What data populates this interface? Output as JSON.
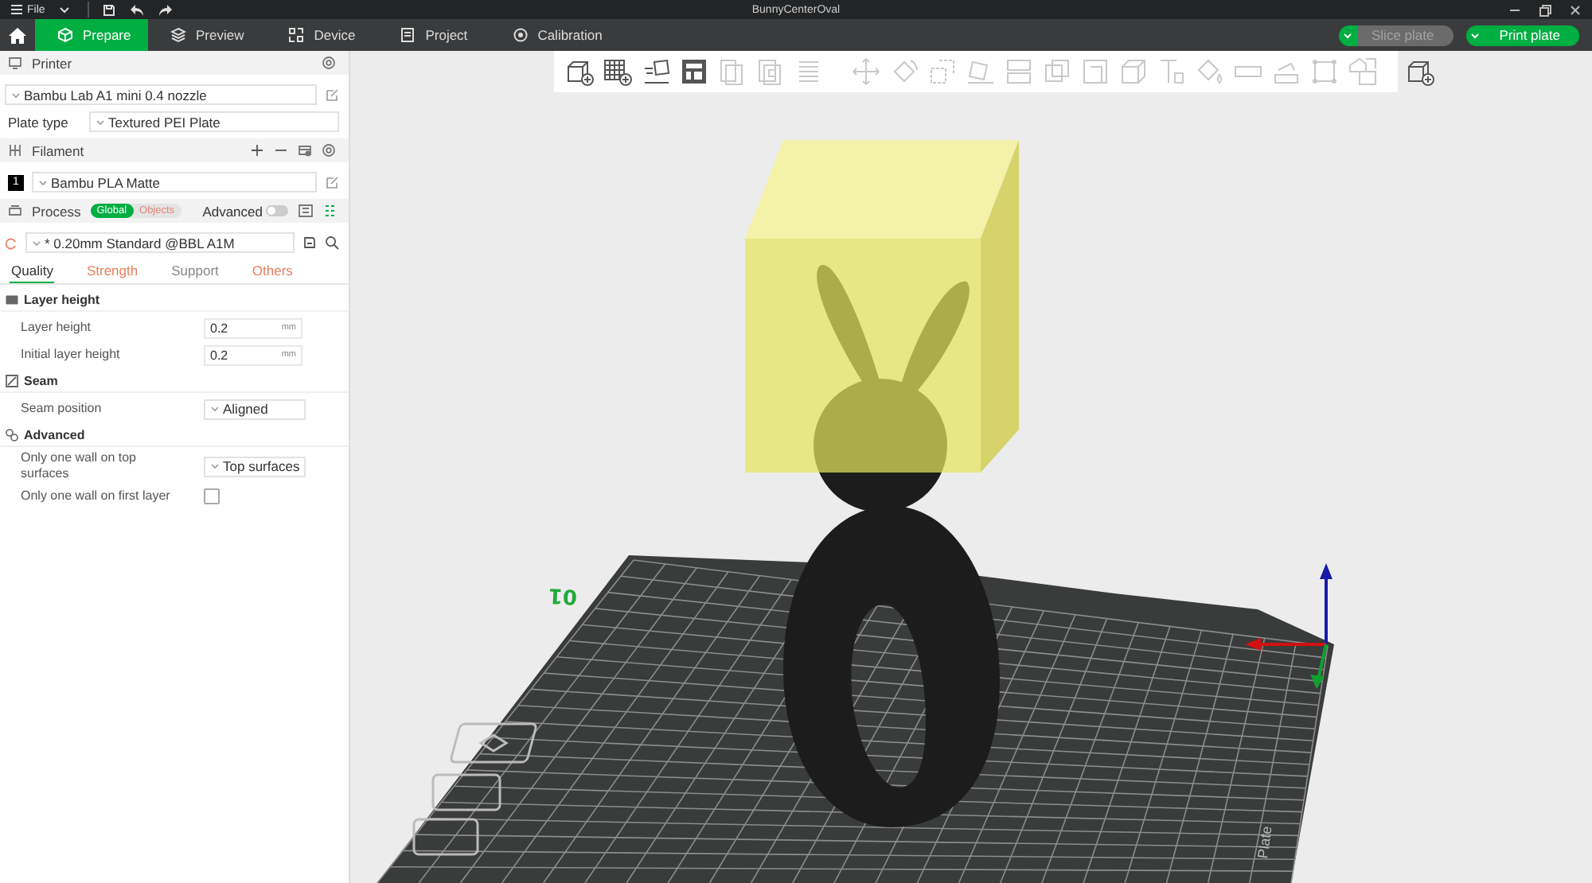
{
  "title_bar": {
    "menu": "File",
    "title": "BunnyCenterOval"
  },
  "tabs": [
    {
      "label": "Prepare",
      "selected": true
    },
    {
      "label": "Preview",
      "selected": false
    },
    {
      "label": "Device",
      "selected": false
    },
    {
      "label": "Project",
      "selected": false
    },
    {
      "label": "Calibration",
      "selected": false
    }
  ],
  "actions": [
    {
      "label": "Slice plate",
      "disabled": true
    },
    {
      "label": "Print plate",
      "disabled": false
    }
  ],
  "printer": {
    "header": "Printer",
    "preset": "Bambu Lab A1 mini 0.4 nozzle",
    "plate_type_label": "Plate type",
    "plate_type": "Textured PEI Plate"
  },
  "filament": {
    "header": "Filament",
    "items": [
      {
        "number": "1",
        "color": "#000000",
        "name": "Bambu PLA Matte"
      }
    ]
  },
  "process": {
    "header": "Process",
    "scopes": [
      {
        "label": "Global",
        "selected": true
      },
      {
        "label": "Objects",
        "selected": false
      }
    ],
    "advanced_label": "Advanced",
    "advanced_on": false,
    "preset": "* 0.20mm Standard @BBL A1M"
  },
  "setting_tabs": [
    {
      "label": "Quality",
      "selected": true,
      "modified": false
    },
    {
      "label": "Strength",
      "selected": false,
      "modified": true
    },
    {
      "label": "Support",
      "selected": false,
      "modified": false
    },
    {
      "label": "Others",
      "selected": false,
      "modified": true
    }
  ],
  "sections": [
    {
      "title": "Layer height",
      "rows": [
        {
          "kind": "number",
          "label": "Layer height",
          "value": "0.2",
          "unit": "mm"
        },
        {
          "kind": "number",
          "label": "Initial layer height",
          "value": "0.2",
          "unit": "mm"
        }
      ]
    },
    {
      "title": "Seam",
      "rows": [
        {
          "kind": "select",
          "label": "Seam position",
          "value": "Aligned"
        }
      ]
    },
    {
      "title": "Advanced",
      "rows": [
        {
          "kind": "select",
          "label": "Only one wall on top surfaces",
          "value": "Top surfaces"
        },
        {
          "kind": "checkbox",
          "label": "Only one wall on first layer",
          "checked": false
        }
      ]
    }
  ],
  "toolbar": [
    [
      {
        "disabled": false
      },
      {
        "disabled": false
      },
      {
        "disabled": false
      },
      {
        "disabled": false
      },
      {
        "disabled": true
      },
      {
        "disabled": true
      },
      {
        "disabled": true
      }
    ],
    [
      {
        "disabled": true
      },
      {
        "disabled": true
      },
      {
        "disabled": true
      },
      {
        "disabled": true
      },
      {
        "disabled": true
      },
      {
        "disabled": true
      },
      {
        "disabled": true
      },
      {
        "disabled": true
      },
      {
        "disabled": true
      },
      {
        "disabled": true
      },
      {
        "disabled": true
      },
      {
        "disabled": true
      },
      {
        "disabled": true
      },
      {
        "disabled": true
      }
    ],
    [
      {
        "disabled": false
      }
    ]
  ],
  "scene": {
    "plate_number": "01",
    "bed_label": "Plate"
  }
}
